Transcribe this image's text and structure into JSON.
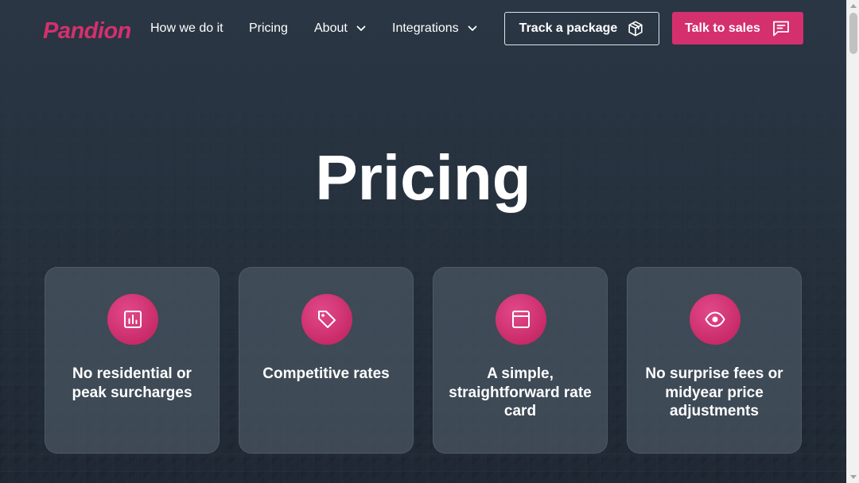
{
  "brand": {
    "name": "Pandion",
    "accent": "#d4306e"
  },
  "nav": {
    "links": [
      {
        "label": "How we do it"
      },
      {
        "label": "Pricing"
      },
      {
        "label": "About",
        "icon": "chevron-down-icon"
      },
      {
        "label": "Integrations",
        "icon": "chevron-down-icon"
      }
    ],
    "track_label": "Track a package",
    "track_icon": "package-icon",
    "sales_label": "Talk to sales",
    "sales_icon": "chat-icon"
  },
  "hero": {
    "title": "Pricing"
  },
  "features": [
    {
      "icon": "bar-chart-icon",
      "text": "No residential or peak surcharges"
    },
    {
      "icon": "tag-icon",
      "text": "Competitive rates"
    },
    {
      "icon": "rate-card-icon",
      "text": "A simple, straightforward rate card"
    },
    {
      "icon": "eye-icon",
      "text": "No surprise fees or midyear price adjustments"
    }
  ]
}
